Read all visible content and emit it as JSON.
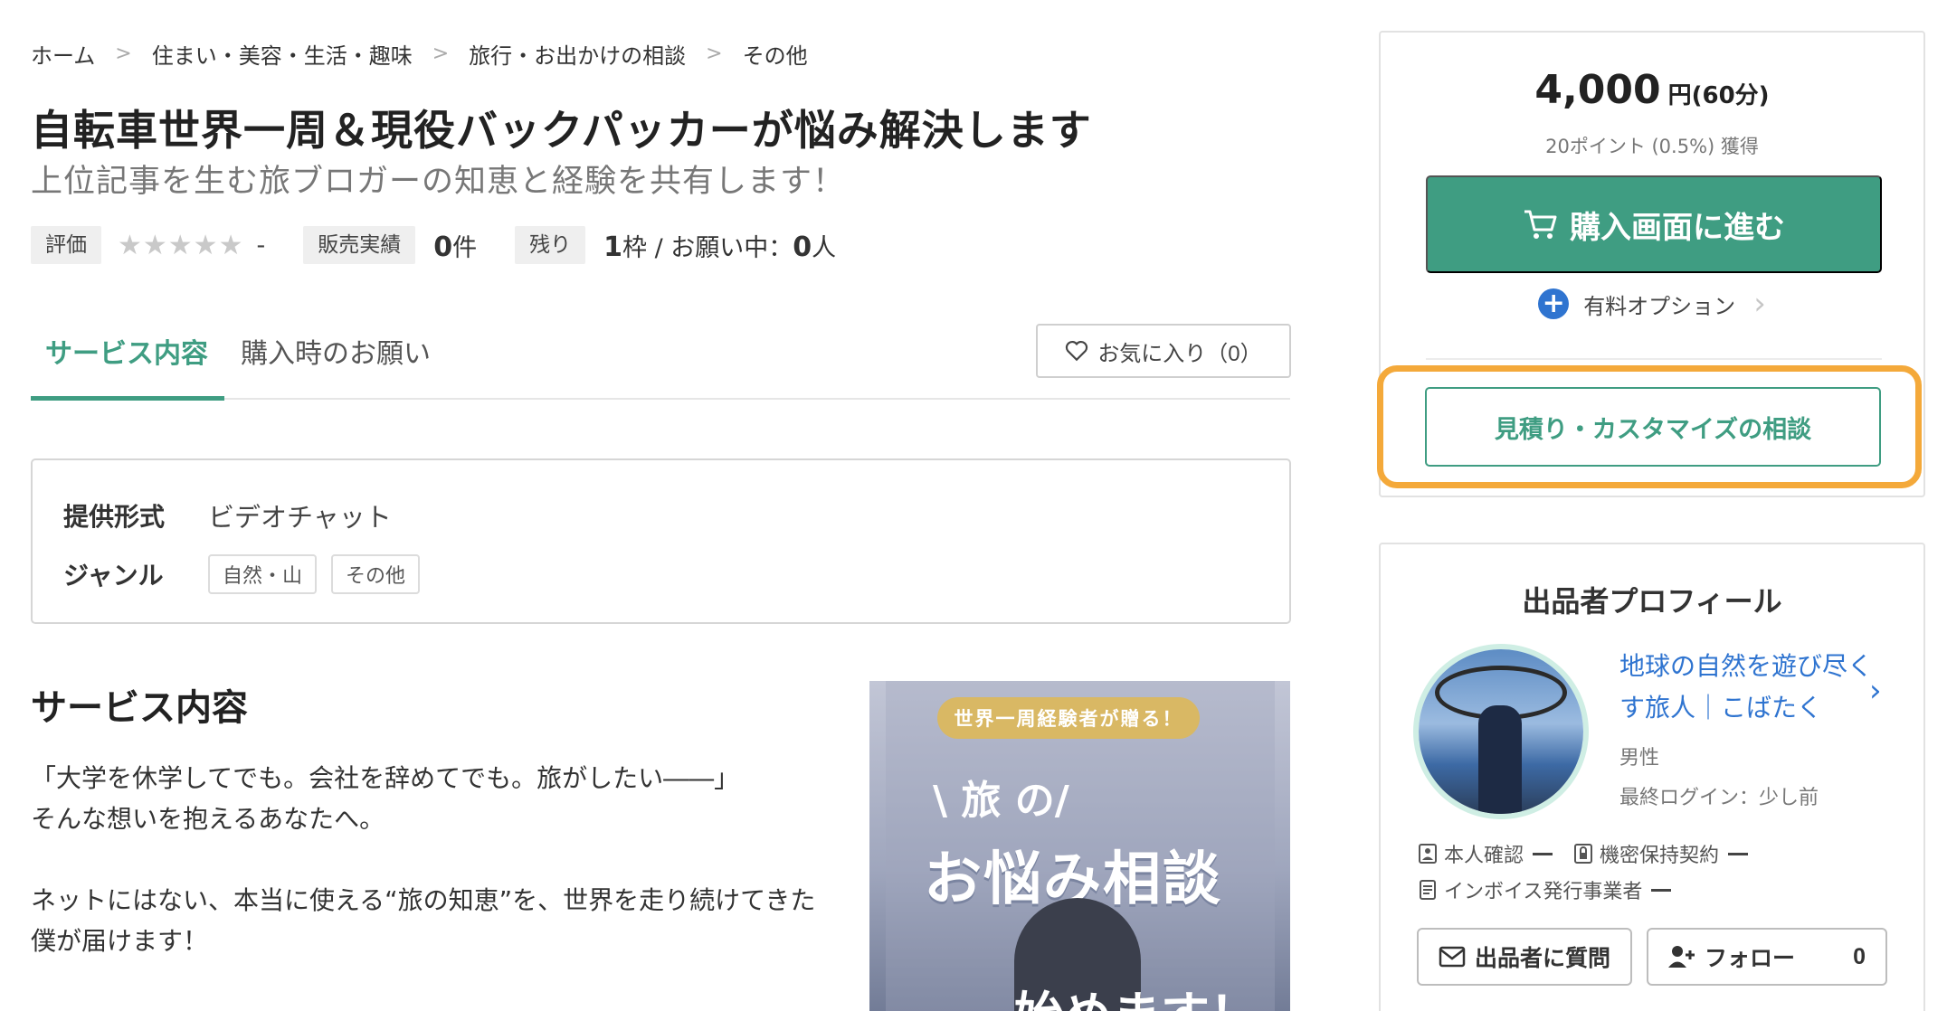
{
  "breadcrumb": [
    "ホーム",
    "住まい・美容・生活・趣味",
    "旅行・お出かけの相談",
    "その他"
  ],
  "title": "自転車世界一周＆現役バックパッカーが悩み解決します",
  "subtitle": "上位記事を生む旅ブロガーの知恵と経験を共有します！",
  "meta": {
    "rating_label": "評価",
    "rating_stars": "★★★★★",
    "rating_value": "-",
    "sales_label": "販売実績",
    "sales_value": "0",
    "sales_unit": "件",
    "remaining_label": "残り",
    "remaining_value": "1",
    "remaining_text": "枠 / お願い中：",
    "requesting_value": "0",
    "requesting_unit": "人"
  },
  "tabs": [
    "サービス内容",
    "購入時のお願い"
  ],
  "favorite": {
    "label": "お気に入り（0）"
  },
  "info": {
    "format_label": "提供形式",
    "format_value": "ビデオチャット",
    "genre_label": "ジャンル",
    "genre_tags": [
      "自然・山",
      "その他"
    ]
  },
  "section_title": "サービス内容",
  "description": [
    "「大学を休学してでも。会社を辞めてでも。旅がしたい――」",
    "そんな想いを抱えるあなたへ。",
    "",
    "ネットにはない、本当に使える“旅の知恵”を、世界を走り続けてきた",
    "僕が届けます！"
  ],
  "promo": {
    "banner": "世界一周経験者が贈る！",
    "tabi": "\\ 旅 の/",
    "headline": "お悩み相談",
    "bottom": "始めます！"
  },
  "price": {
    "amount": "4,000",
    "unit": "円(60分)",
    "points": "20ポイント (0.5%) 獲得",
    "buy_label": "購入画面に進む",
    "option_label": "有料オプション",
    "quote_label": "見積り・カスタマイズの相談"
  },
  "profile": {
    "title": "出品者プロフィール",
    "name": "地球の自然を遊び尽くす旅人｜こばたく",
    "gender": "男性",
    "last_login": "最終ログイン：少し前",
    "badges": [
      "本人確認",
      "機密保持契約",
      "インボイス発行事業者"
    ],
    "ask_label": "出品者に質問",
    "follow_label": "フォロー",
    "follow_count": "0"
  },
  "colors": {
    "accent": "#3f9d82",
    "link": "#2f74d0",
    "highlight": "#f4a93a"
  },
  "icons": [
    "cart-icon",
    "plus-icon",
    "chevron-right-icon",
    "heart-icon",
    "user-icon",
    "lock-icon",
    "document-icon",
    "mail-icon",
    "user-plus-icon"
  ]
}
